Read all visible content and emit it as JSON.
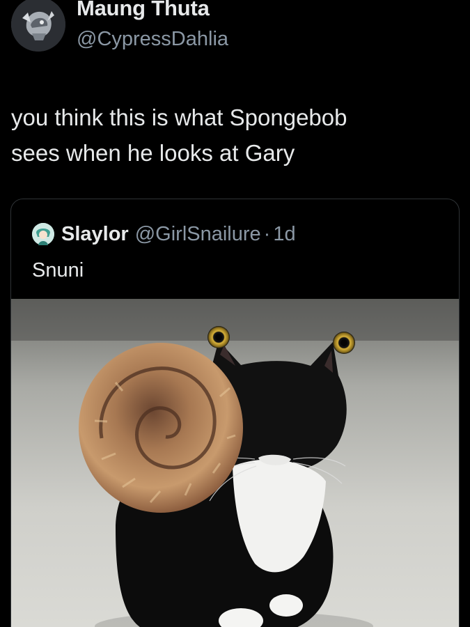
{
  "author": {
    "display_name": "Maung Thuta",
    "handle": "@CypressDahlia",
    "avatar_icon": "helmet-avatar-icon"
  },
  "tweet": {
    "lines": [
      "you think this is what Spongebob",
      "sees when he looks at Gary"
    ]
  },
  "quoted": {
    "display_name": "Slaylor",
    "handle": "@GirlSnailure",
    "separator": "·",
    "time": "1d",
    "text": "Snuni",
    "avatar_icon": "anime-avatar-icon",
    "image_icon": "cat-with-snail-shell-image"
  },
  "colors": {
    "background": "#000000",
    "primary_text": "#e7e9ea",
    "secondary_text": "#8b98a5",
    "card_border": "#2f3336"
  }
}
